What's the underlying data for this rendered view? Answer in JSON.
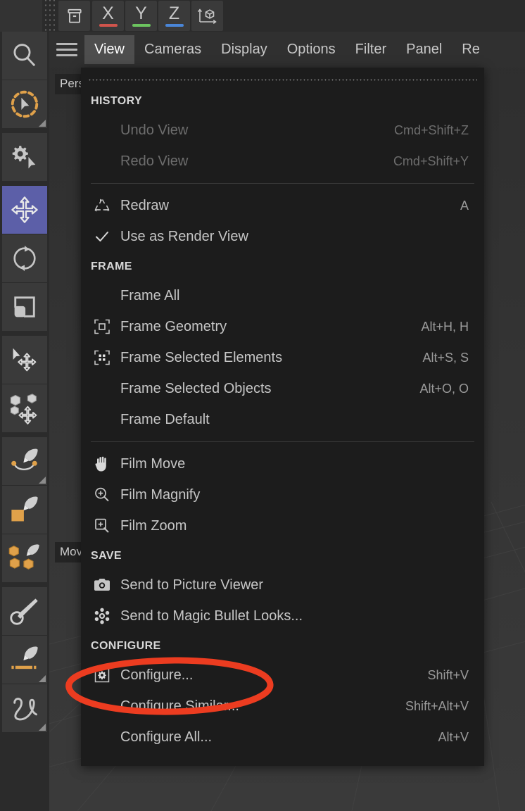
{
  "toolbar": {
    "archive_icon": "archive-box-icon",
    "axes": [
      {
        "letter": "X",
        "color": "#d0544c"
      },
      {
        "letter": "Y",
        "color": "#6cc45f"
      },
      {
        "letter": "Z",
        "color": "#4a86d8"
      }
    ],
    "gizmo_icon": "axis-cube-icon"
  },
  "rail": {
    "items": [
      {
        "name": "search-tool",
        "icon": "magnifier-icon",
        "active": false,
        "corner": false
      },
      {
        "name": "live-selection-tool",
        "icon": "dashed-circle-cursor-icon",
        "active": false,
        "corner": true
      },
      {
        "name": "tool-settings",
        "icon": "gear-cursor-icon",
        "active": false,
        "corner": false
      },
      {
        "name": "move-tool",
        "icon": "move-arrows-icon",
        "active": true,
        "corner": false
      },
      {
        "name": "rotate-tool",
        "icon": "rotate-arrows-icon",
        "active": false,
        "corner": false
      },
      {
        "name": "scale-tool",
        "icon": "scale-square-icon",
        "active": false,
        "corner": false
      },
      {
        "name": "transform-tool",
        "icon": "cursor-move-icon",
        "active": false,
        "corner": false
      },
      {
        "name": "multi-object-tool",
        "icon": "cubes-move-icon",
        "active": false,
        "corner": false
      },
      {
        "name": "spline-pen-tool",
        "icon": "pen-curve-icon",
        "active": false,
        "corner": true
      },
      {
        "name": "polygon-pen-tool",
        "icon": "pen-square-icon",
        "active": false,
        "corner": false
      },
      {
        "name": "poly-brush-tool",
        "icon": "pen-cubes-icon",
        "active": false,
        "corner": false
      },
      {
        "name": "paint-brush-tool",
        "icon": "brush-icon",
        "active": false,
        "corner": false
      },
      {
        "name": "line-pen-tool",
        "icon": "pen-dashline-icon",
        "active": false,
        "corner": true
      },
      {
        "name": "sculpt-tool",
        "icon": "squiggle-icon",
        "active": false,
        "corner": true
      }
    ]
  },
  "menubar": {
    "hamburger_icon": "hamburger-icon",
    "items": [
      {
        "label": "View",
        "selected": true
      },
      {
        "label": "Cameras",
        "selected": false
      },
      {
        "label": "Display",
        "selected": false
      },
      {
        "label": "Options",
        "selected": false
      },
      {
        "label": "Filter",
        "selected": false
      },
      {
        "label": "Panel",
        "selected": false
      },
      {
        "label": "Re",
        "selected": false
      }
    ]
  },
  "viewport": {
    "perspective_label": "Pers",
    "mode_label": "Mov"
  },
  "dropdown": {
    "sections": [
      {
        "title": "HISTORY",
        "rows": [
          {
            "label": "Undo View",
            "shortcut": "Cmd+Shift+Z",
            "icon": "",
            "disabled": true
          },
          {
            "label": "Redo View",
            "shortcut": "Cmd+Shift+Y",
            "icon": "",
            "disabled": true
          }
        ],
        "divider_after": true
      },
      {
        "title": "",
        "rows": [
          {
            "label": "Redraw",
            "shortcut": "A",
            "icon": "redraw-icon",
            "disabled": false
          },
          {
            "label": "Use as Render View",
            "shortcut": "",
            "icon": "checkmark-icon",
            "disabled": false
          }
        ],
        "divider_after": false
      },
      {
        "title": "FRAME",
        "rows": [
          {
            "label": "Frame All",
            "shortcut": "",
            "icon": "",
            "disabled": false
          },
          {
            "label": "Frame Geometry",
            "shortcut": "Alt+H, H",
            "icon": "frame-geometry-icon",
            "disabled": false
          },
          {
            "label": "Frame Selected Elements",
            "shortcut": "Alt+S, S",
            "icon": "frame-elements-icon",
            "disabled": false
          },
          {
            "label": "Frame Selected Objects",
            "shortcut": "Alt+O, O",
            "icon": "",
            "disabled": false
          },
          {
            "label": "Frame Default",
            "shortcut": "",
            "icon": "",
            "disabled": false
          }
        ],
        "divider_after": true
      },
      {
        "title": "",
        "rows": [
          {
            "label": "Film Move",
            "shortcut": "",
            "icon": "hand-icon",
            "disabled": false
          },
          {
            "label": "Film Magnify",
            "shortcut": "",
            "icon": "magnify-plus-icon",
            "disabled": false
          },
          {
            "label": "Film Zoom",
            "shortcut": "",
            "icon": "zoom-box-icon",
            "disabled": false
          }
        ],
        "divider_after": false
      },
      {
        "title": "SAVE",
        "rows": [
          {
            "label": "Send to Picture Viewer",
            "shortcut": "",
            "icon": "camera-icon",
            "disabled": false
          },
          {
            "label": "Send to Magic Bullet Looks...",
            "shortcut": "",
            "icon": "magic-bullet-icon",
            "disabled": false
          }
        ],
        "divider_after": false
      },
      {
        "title": "CONFIGURE",
        "rows": [
          {
            "label": "Configure...",
            "shortcut": "Shift+V",
            "icon": "configure-gear-icon",
            "disabled": false
          },
          {
            "label": "Configure Similar...",
            "shortcut": "Shift+Alt+V",
            "icon": "",
            "disabled": false
          },
          {
            "label": "Configure All...",
            "shortcut": "Alt+V",
            "icon": "",
            "disabled": false
          }
        ],
        "divider_after": false
      }
    ]
  },
  "annotation": {
    "shape": "ellipse-highlight",
    "color": "#ec3c20",
    "target": "Configure..."
  },
  "colors": {
    "accent_active": "#5c5fa8",
    "menu_bg": "#1c1c1c",
    "panel_bg": "#2b2b2b",
    "annotation_red": "#ec3c20",
    "tool_orange": "#e3a košt"
  }
}
